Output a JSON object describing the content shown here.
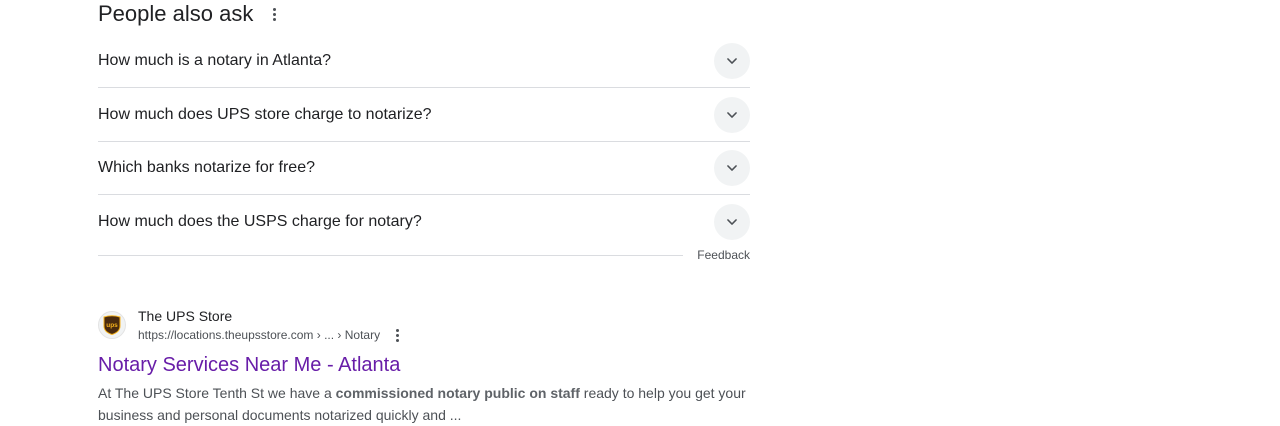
{
  "people_also_ask": {
    "title": "People also ask",
    "questions": [
      "How much is a notary in Atlanta?",
      "How much does UPS store charge to notarize?",
      "Which banks notarize for free?",
      "How much does the USPS charge for notary?"
    ],
    "feedback_label": "Feedback"
  },
  "result": {
    "site_name": "The UPS Store",
    "favicon_text": "ups",
    "url": "https://locations.theupsstore.com › ... › Notary",
    "title": "Notary Services Near Me - Atlanta",
    "snippet_before": "At The UPS Store Tenth St we have a ",
    "snippet_bold": "commissioned notary public on staff",
    "snippet_after": " ready to help you get your business and personal documents notarized quickly and ...",
    "title_color": "#681da8"
  },
  "icons": {
    "more_options": "kebab-icon",
    "expand": "chevron-down-icon",
    "favicon": "ups-shield-logo"
  }
}
